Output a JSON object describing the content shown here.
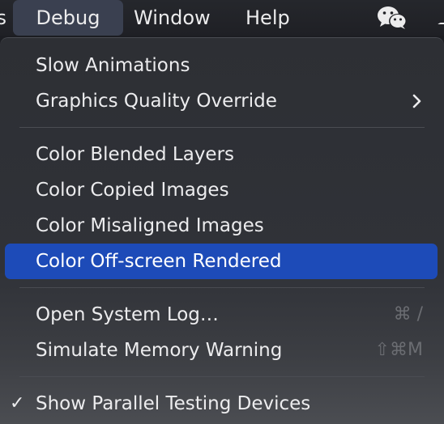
{
  "menubar": {
    "partial_label": "s",
    "debug_label": "Debug",
    "window_label": "Window",
    "help_label": "Help",
    "wechat_icon": "wechat-icon"
  },
  "menu": {
    "slow_animations": "Slow Animations",
    "graphics_quality_override": "Graphics Quality Override",
    "color_blended_layers": "Color Blended Layers",
    "color_copied_images": "Color Copied Images",
    "color_misaligned_images": "Color Misaligned Images",
    "color_offscreen_rendered": "Color Off-screen Rendered",
    "open_system_log": "Open System Log…",
    "open_system_log_shortcut": "⌘ /",
    "simulate_memory_warning": "Simulate Memory Warning",
    "simulate_memory_warning_shortcut": "⇧⌘M",
    "show_parallel_testing_devices": "Show Parallel Testing Devices",
    "checkmark": "✓"
  },
  "colors": {
    "highlight": "#1d4bb8",
    "menu_background": "#2d2f34",
    "shortcut_text": "#6b6d72"
  }
}
